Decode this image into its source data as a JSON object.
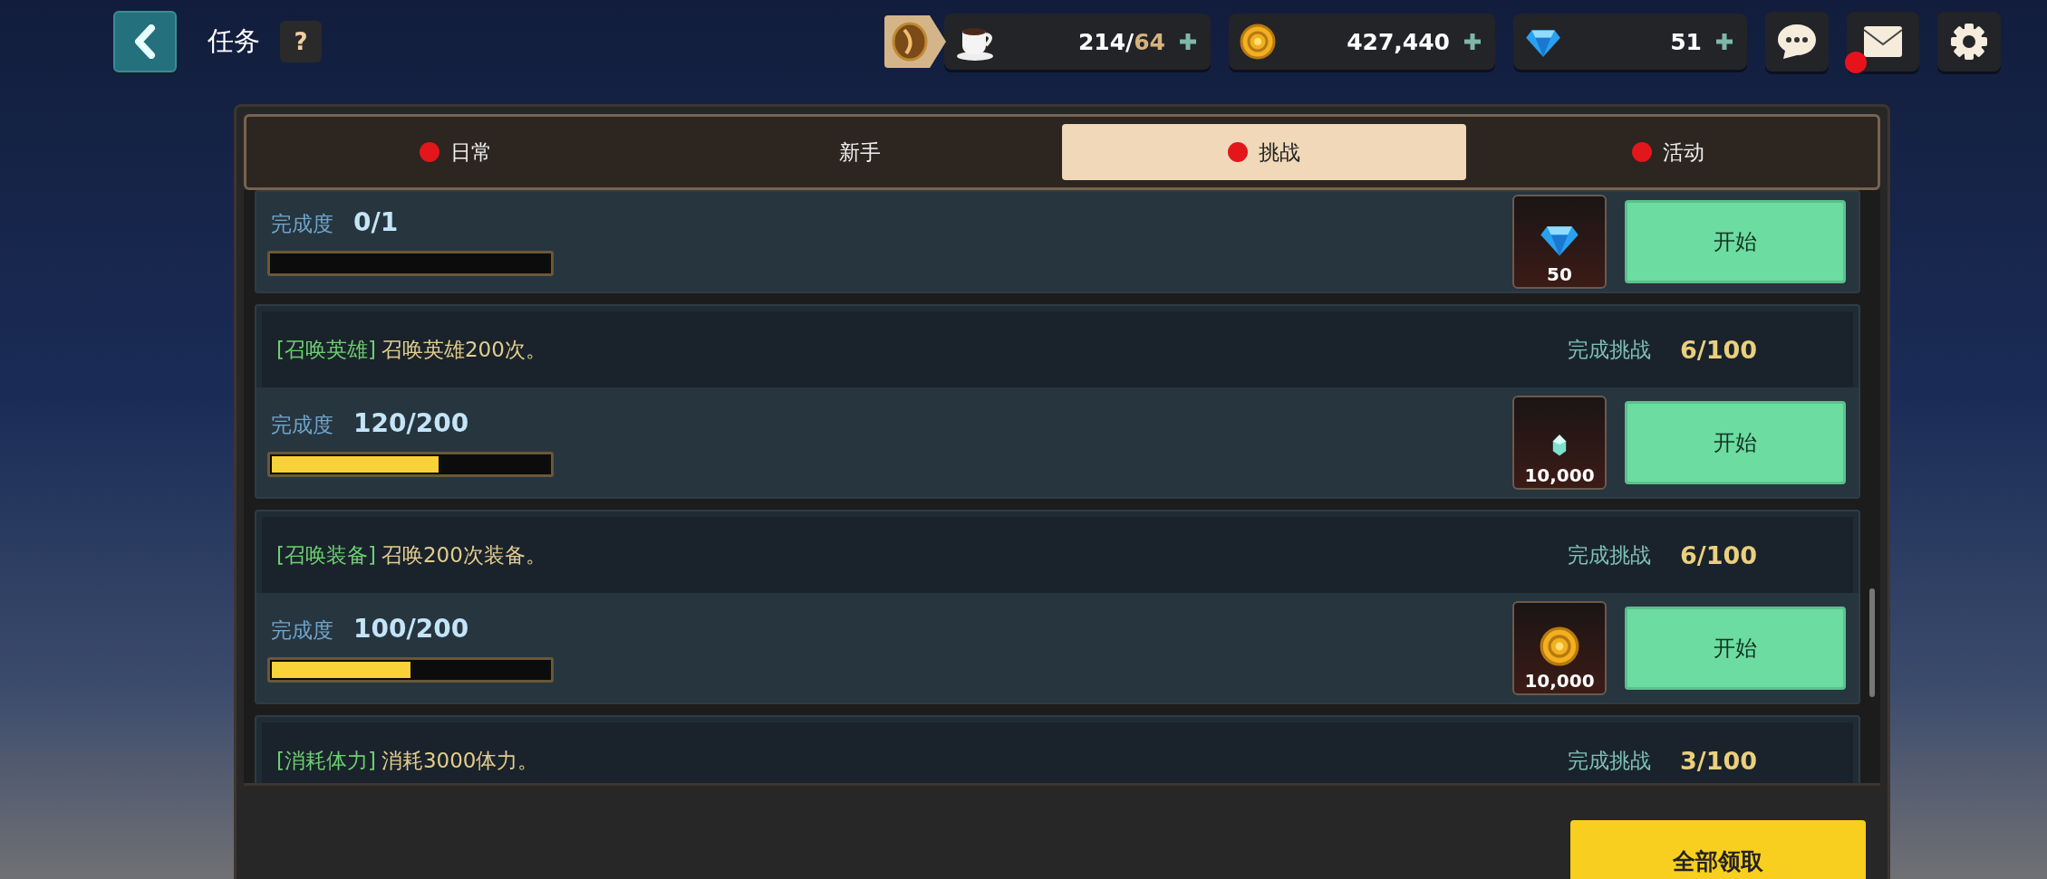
{
  "header": {
    "title": "任务",
    "help": "?"
  },
  "resources": [
    {
      "kind": "stamina",
      "value": "214/",
      "max": "64"
    },
    {
      "kind": "gold",
      "value": "427,440"
    },
    {
      "kind": "gem",
      "value": "51"
    }
  ],
  "mail": {
    "notification": true
  },
  "tabs": [
    {
      "label": "日常",
      "selected": false,
      "badge": true
    },
    {
      "label": "新手",
      "selected": false,
      "badge": false
    },
    {
      "label": "挑战",
      "selected": true,
      "badge": true
    },
    {
      "label": "活动",
      "selected": false,
      "badge": true
    }
  ],
  "tasks": [
    {
      "progress_label": "完成度",
      "progress": "0/1",
      "level": 0,
      "reward": {
        "kind": "gem",
        "amount": "50"
      },
      "button": "开始"
    },
    {
      "tag": "[召唤英雄]",
      "description": "召唤英雄200次。",
      "challenge_label": "完成挑战",
      "challenge": "6/100",
      "progress_label": "完成度",
      "progress": "120/200",
      "level": 0.6,
      "reward": {
        "kind": "crystal",
        "amount": "10,000"
      },
      "button": "开始"
    },
    {
      "tag": "[召唤装备]",
      "description": "召唤200次装备。",
      "challenge_label": "完成挑战",
      "challenge": "6/100",
      "progress_label": "完成度",
      "progress": "100/200",
      "level": 0.5,
      "reward": {
        "kind": "gold",
        "amount": "10,000"
      },
      "button": "开始"
    },
    {
      "tag": "[消耗体力]",
      "description": "消耗3000体力。",
      "challenge_label": "完成挑战",
      "challenge": "3/100"
    }
  ],
  "claim_all": "全部领取"
}
